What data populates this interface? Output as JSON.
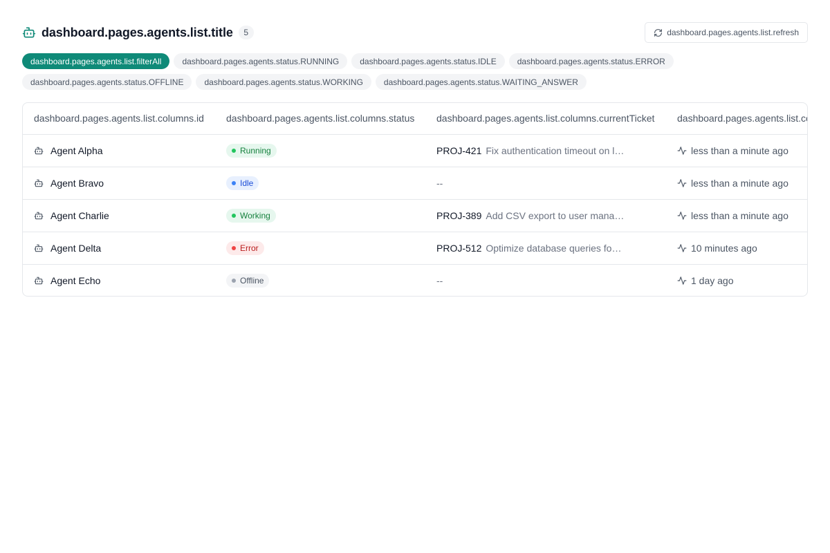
{
  "header": {
    "title": "dashboard.pages.agents.list.title",
    "count": "5",
    "refresh_label": "dashboard.pages.agents.list.refresh",
    "title_icon": "bot-icon",
    "refresh_icon": "refresh-icon"
  },
  "filters": [
    {
      "label": "dashboard.pages.agents.list.filterAll",
      "active": true
    },
    {
      "label": "dashboard.pages.agents.status.RUNNING",
      "active": false
    },
    {
      "label": "dashboard.pages.agents.status.IDLE",
      "active": false
    },
    {
      "label": "dashboard.pages.agents.status.ERROR",
      "active": false
    },
    {
      "label": "dashboard.pages.agents.status.OFFLINE",
      "active": false
    },
    {
      "label": "dashboard.pages.agents.status.WORKING",
      "active": false
    },
    {
      "label": "dashboard.pages.agents.status.WAITING_ANSWER",
      "active": false
    }
  ],
  "table": {
    "columns": [
      "dashboard.pages.agents.list.columns.id",
      "dashboard.pages.agents.list.columns.status",
      "dashboard.pages.agents.list.columns.currentTicket",
      "dashboard.pages.agents.list.columns.lastActivity"
    ],
    "rows": [
      {
        "name": "Agent Alpha",
        "status": "Running",
        "ticket_key": "PROJ-421",
        "ticket_title": "Fix authentication timeout on login",
        "empty": "",
        "activity": "less than a minute ago"
      },
      {
        "name": "Agent Bravo",
        "status": "Idle",
        "ticket_key": "",
        "ticket_title": "",
        "empty": "--",
        "activity": "less than a minute ago"
      },
      {
        "name": "Agent Charlie",
        "status": "Working",
        "ticket_key": "PROJ-389",
        "ticket_title": "Add CSV export to user management",
        "empty": "",
        "activity": "less than a minute ago"
      },
      {
        "name": "Agent Delta",
        "status": "Error",
        "ticket_key": "PROJ-512",
        "ticket_title": "Optimize database queries for reports",
        "empty": "",
        "activity": "10 minutes ago"
      },
      {
        "name": "Agent Echo",
        "status": "Offline",
        "ticket_key": "",
        "ticket_title": "",
        "empty": "--",
        "activity": "1 day ago"
      }
    ]
  },
  "colors": {
    "accent": "#0f8a78",
    "status": {
      "Running": {
        "bg": "#e6f7ee",
        "fg": "#15803d",
        "dot": "#22c55e"
      },
      "Idle": {
        "bg": "#e8f0fe",
        "fg": "#1d4ed8",
        "dot": "#3b82f6"
      },
      "Working": {
        "bg": "#e6f7ee",
        "fg": "#15803d",
        "dot": "#22c55e"
      },
      "Error": {
        "bg": "#fdeaea",
        "fg": "#b91c1c",
        "dot": "#ef4444"
      },
      "Offline": {
        "bg": "#f3f4f6",
        "fg": "#4b5563",
        "dot": "#9ca3af"
      }
    }
  }
}
